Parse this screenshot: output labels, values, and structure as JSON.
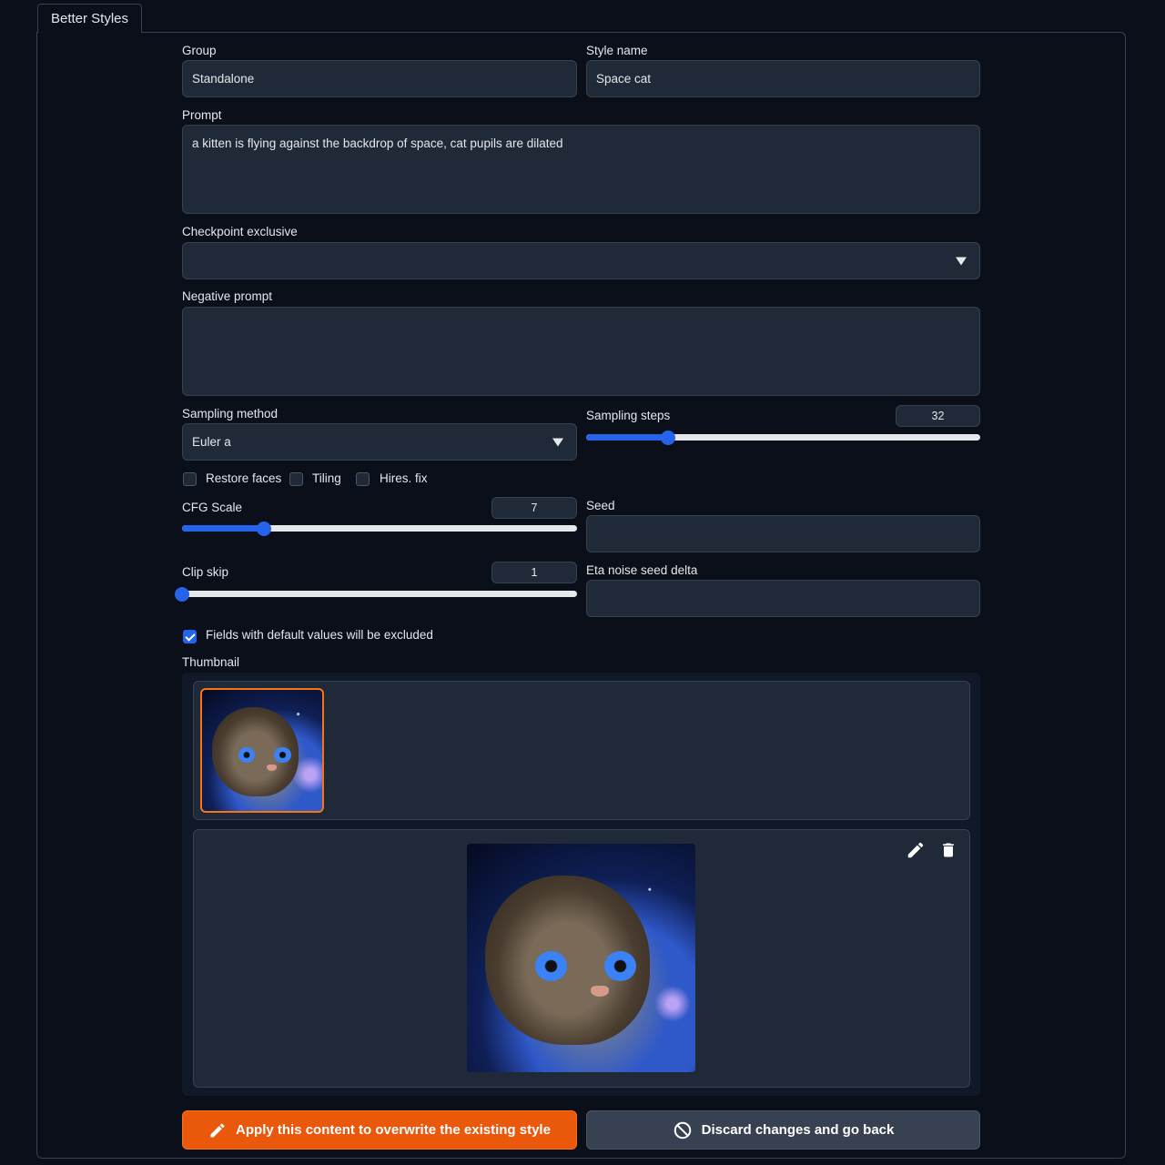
{
  "tab": {
    "label": "Better Styles"
  },
  "form": {
    "group": {
      "label": "Group",
      "value": "Standalone"
    },
    "style_name": {
      "label": "Style name",
      "value": "Space cat"
    },
    "prompt": {
      "label": "Prompt",
      "value": "a kitten is flying against the backdrop of space, cat pupils are dilated"
    },
    "checkpoint": {
      "label": "Checkpoint exclusive",
      "value": ""
    },
    "negative_prompt": {
      "label": "Negative prompt",
      "value": ""
    },
    "sampling_method": {
      "label": "Sampling method",
      "value": "Euler a"
    },
    "sampling_steps": {
      "label": "Sampling steps",
      "value": "32",
      "min": 1,
      "max": 150
    },
    "restore_faces": {
      "label": "Restore faces",
      "checked": false
    },
    "tiling": {
      "label": "Tiling",
      "checked": false
    },
    "hires_fix": {
      "label": "Hires. fix",
      "checked": false
    },
    "cfg_scale": {
      "label": "CFG Scale",
      "value": "7",
      "min": 1,
      "max": 30
    },
    "seed": {
      "label": "Seed",
      "value": ""
    },
    "clip_skip": {
      "label": "Clip skip",
      "value": "1",
      "min": 1,
      "max": 12
    },
    "eta_noise": {
      "label": "Eta noise seed delta",
      "value": ""
    },
    "exclude_defaults": {
      "label": "Fields with default values will be excluded",
      "checked": true
    },
    "thumbnail": {
      "label": "Thumbnail"
    }
  },
  "buttons": {
    "apply": "Apply this content to overwrite the existing style",
    "discard": "Discard changes and go back"
  },
  "colors": {
    "accent": "#2563eb",
    "primary_button": "#ea580c",
    "background": "#0b0f19",
    "field": "#1f2937"
  }
}
